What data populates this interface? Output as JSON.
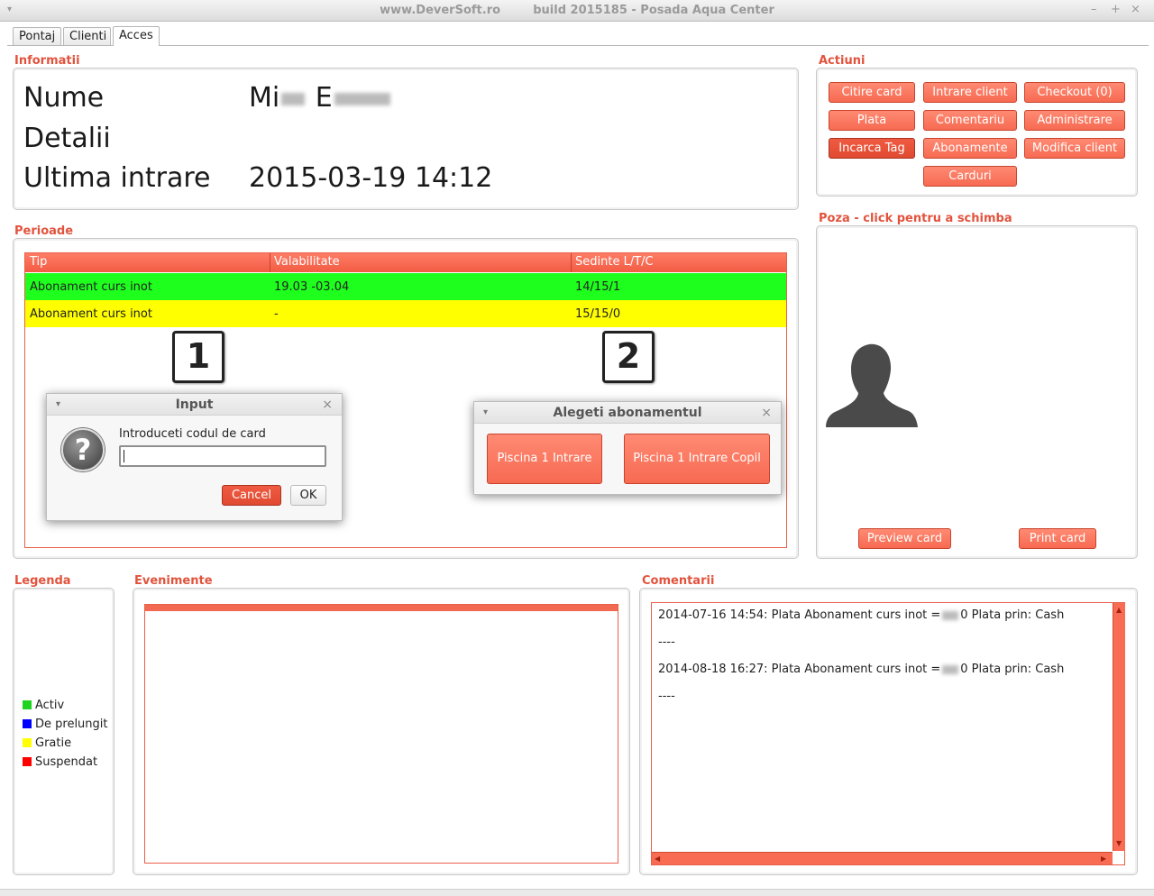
{
  "window": {
    "title": "www.DeverSoft.ro        build 2015185 - Posada Aqua Center",
    "menu_glyph": "▾",
    "minimize": "–",
    "maximize": "+",
    "close": "×"
  },
  "tabs": [
    {
      "label": "Pontaj",
      "active": false
    },
    {
      "label": "Clienti",
      "active": false
    },
    {
      "label": "Acces",
      "active": true
    }
  ],
  "informatii": {
    "title": "Informatii",
    "name_label": "Nume",
    "name_value_a": "Mi",
    "name_value_b": "E",
    "details_label": "Detalii",
    "details_value": "",
    "last_entry_label": "Ultima intrare",
    "last_entry_value": "2015-03-19 14:12"
  },
  "actiuni": {
    "title": "Actiuni",
    "buttons": {
      "citire_card": "Citire card",
      "intrare_client": "Intrare client",
      "checkout": "Checkout (0)",
      "plata": "Plata",
      "comentariu": "Comentariu",
      "administrare": "Administrare",
      "incarca_tag": "Incarca Tag",
      "abonamente": "Abonamente",
      "modifica_client": "Modifica client",
      "carduri": "Carduri"
    }
  },
  "perioade": {
    "title": "Perioade",
    "columns": [
      "Tip",
      "Valabilitate",
      "Sedinte L/T/C"
    ],
    "rows": [
      {
        "tip": "Abonament curs inot",
        "valabilitate": "19.03 -03.04",
        "sedinte": "14/15/1",
        "color": "#1eff1e"
      },
      {
        "tip": "Abonament curs inot",
        "valabilitate": "-",
        "sedinte": "15/15/0",
        "color": "#ffff00"
      }
    ]
  },
  "steps": {
    "one": "1",
    "two": "2"
  },
  "input_dialog": {
    "title": "Input",
    "message": "Introduceti codul de card",
    "value": "",
    "cancel": "Cancel",
    "ok": "OK",
    "icon_glyph": "?"
  },
  "abonament_dialog": {
    "title": "Alegeti abonamentul",
    "option1": "Piscina 1 Intrare",
    "option2": "Piscina 1 Intrare Copil"
  },
  "poza": {
    "title": "Poza - click pentru a schimba",
    "preview": "Preview card",
    "print": "Print card"
  },
  "legenda": {
    "title": "Legenda",
    "items": [
      {
        "label": "Activ",
        "color": "#1ed41e"
      },
      {
        "label": "De prelungit",
        "color": "#0000ff"
      },
      {
        "label": "Gratie",
        "color": "#ffff00"
      },
      {
        "label": "Suspendat",
        "color": "#ff0000"
      }
    ]
  },
  "evenimente": {
    "title": "Evenimente"
  },
  "comentarii": {
    "title": "Comentarii",
    "lines": [
      "2014-07-16 14:54: Plata Abonament curs inot =",
      "0 Plata prin: Cash",
      "----",
      "2014-08-18 16:27: Plata Abonament curs inot =",
      "0 Plata prin: Cash",
      "----"
    ]
  }
}
